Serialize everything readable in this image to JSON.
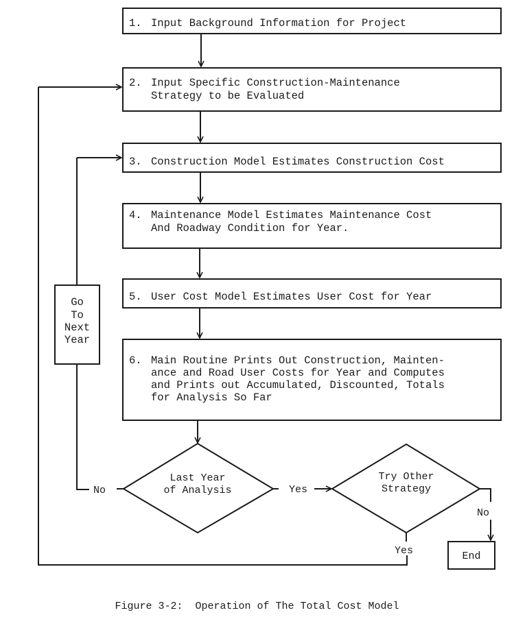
{
  "diagram": {
    "steps": [
      {
        "id": 1,
        "num": "1.",
        "lines": [
          "Input Background Information for Project"
        ]
      },
      {
        "id": 2,
        "num": "2.",
        "lines": [
          "Input Specific Construction-Maintenance",
          "Strategy to be Evaluated"
        ]
      },
      {
        "id": 3,
        "num": "3.",
        "lines": [
          "Construction Model Estimates Construction Cost"
        ]
      },
      {
        "id": 4,
        "num": "4.",
        "lines": [
          "Maintenance Model Estimates Maintenance Cost",
          "And Roadway Condition for Year."
        ]
      },
      {
        "id": 5,
        "num": "5.",
        "lines": [
          "User Cost Model Estimates User Cost for Year"
        ]
      },
      {
        "id": 6,
        "num": "6.",
        "lines": [
          "Main Routine Prints Out Construction, Mainten-",
          "ance and Road User Costs for Year and Computes",
          "and Prints out Accumulated, Discounted, Totals",
          "for Analysis So Far"
        ]
      }
    ],
    "loop_box": {
      "lines": [
        "Go",
        "To",
        "Next",
        "Year"
      ]
    },
    "decisions": [
      {
        "id": "last-year",
        "lines": [
          "Last Year",
          "of Analysis"
        ],
        "no_label": "No",
        "yes_label": "Yes"
      },
      {
        "id": "try-other",
        "lines": [
          "Try Other",
          "Strategy"
        ],
        "no_label": "No",
        "yes_label": "Yes"
      }
    ],
    "terminal": {
      "label": "End"
    },
    "caption": "Figure 3-2:  Operation of The Total Cost Model"
  }
}
